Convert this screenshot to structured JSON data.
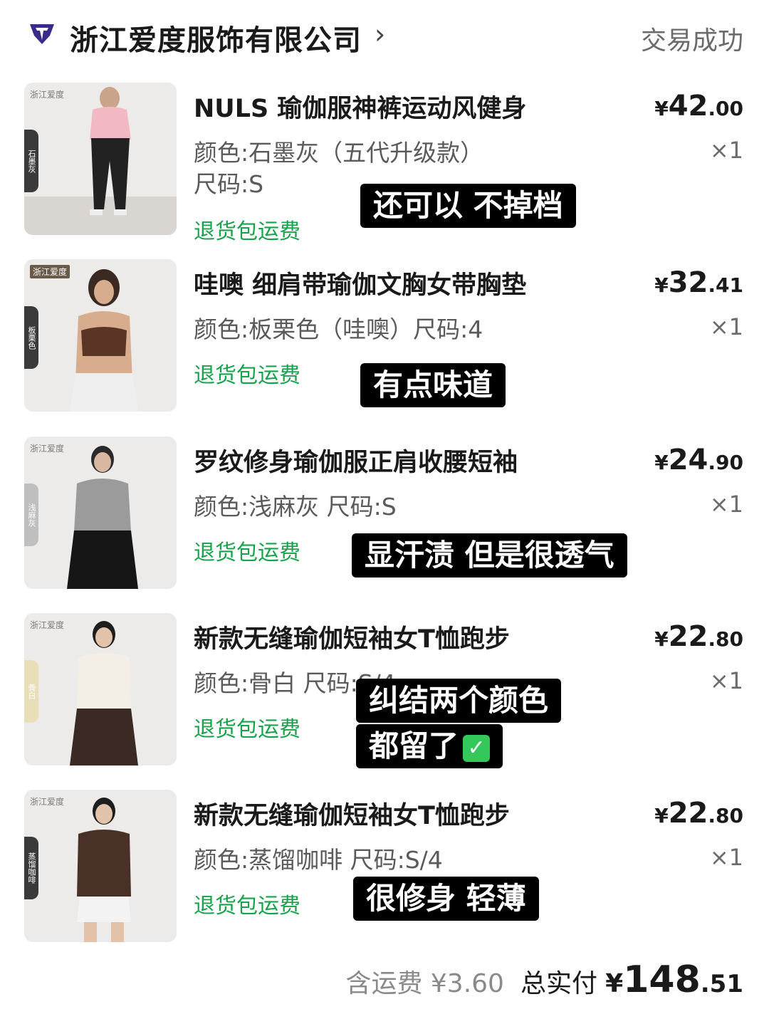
{
  "header": {
    "shop_name": "浙江爱度服饰有限公司",
    "chevron": "›",
    "status": "交易成功"
  },
  "items": [
    {
      "title": "NULS 瑜伽服神裤运动风健身",
      "spec_line1": "颜色:石墨灰（五代升级款）",
      "spec_line2": "尺码:S",
      "return_label": "退货包运费",
      "price_yen": "¥",
      "price_int": "42",
      "price_dec": ".00",
      "qty": "×1",
      "thumb_brand": "浙江爱度",
      "thumb_tag": "石墨灰",
      "note": "还可以 不掉档"
    },
    {
      "title": "哇噢 细肩带瑜伽文胸女带胸垫",
      "spec_line1": "颜色:板栗色（哇噢）尺码:4",
      "spec_line2": "",
      "return_label": "退货包运费",
      "price_yen": "¥",
      "price_int": "32",
      "price_dec": ".41",
      "qty": "×1",
      "thumb_brand": "浙江爱度",
      "thumb_tag": "板栗色",
      "note": "有点味道"
    },
    {
      "title": "罗纹修身瑜伽服正肩收腰短袖",
      "spec_line1": "颜色:浅麻灰 尺码:S",
      "spec_line2": "",
      "return_label": "退货包运费",
      "price_yen": "¥",
      "price_int": "24",
      "price_dec": ".90",
      "qty": "×1",
      "thumb_brand": "浙江爱度",
      "thumb_tag": "浅麻灰",
      "note": "显汗渍 但是很透气"
    },
    {
      "title": "新款无缝瑜伽短袖女T恤跑步",
      "spec_line1": "颜色:骨白 尺码:S/4",
      "spec_line2": "",
      "return_label": "退货包运费",
      "price_yen": "¥",
      "price_int": "22",
      "price_dec": ".80",
      "qty": "×1",
      "thumb_brand": "浙江爱度",
      "thumb_tag": "骨白",
      "note_line1": "纠结两个颜色",
      "note_line2": "都留了",
      "note_check": "✓"
    },
    {
      "title": "新款无缝瑜伽短袖女T恤跑步",
      "spec_line1": "颜色:蒸馏咖啡 尺码:S/4",
      "spec_line2": "",
      "return_label": "退货包运费",
      "price_yen": "¥",
      "price_int": "22",
      "price_dec": ".80",
      "qty": "×1",
      "thumb_brand": "浙江爱度",
      "thumb_tag": "蒸馏咖啡",
      "note": "很修身 轻薄"
    }
  ],
  "footer": {
    "shipping": "含运费 ¥3.60",
    "total_label": "总实付",
    "total_yen": "¥",
    "total_int": "148",
    "total_dec": ".51"
  },
  "colors": {
    "green": "#17a34a",
    "note_bg": "#000000",
    "logo_purple": "#3a2a8a"
  }
}
